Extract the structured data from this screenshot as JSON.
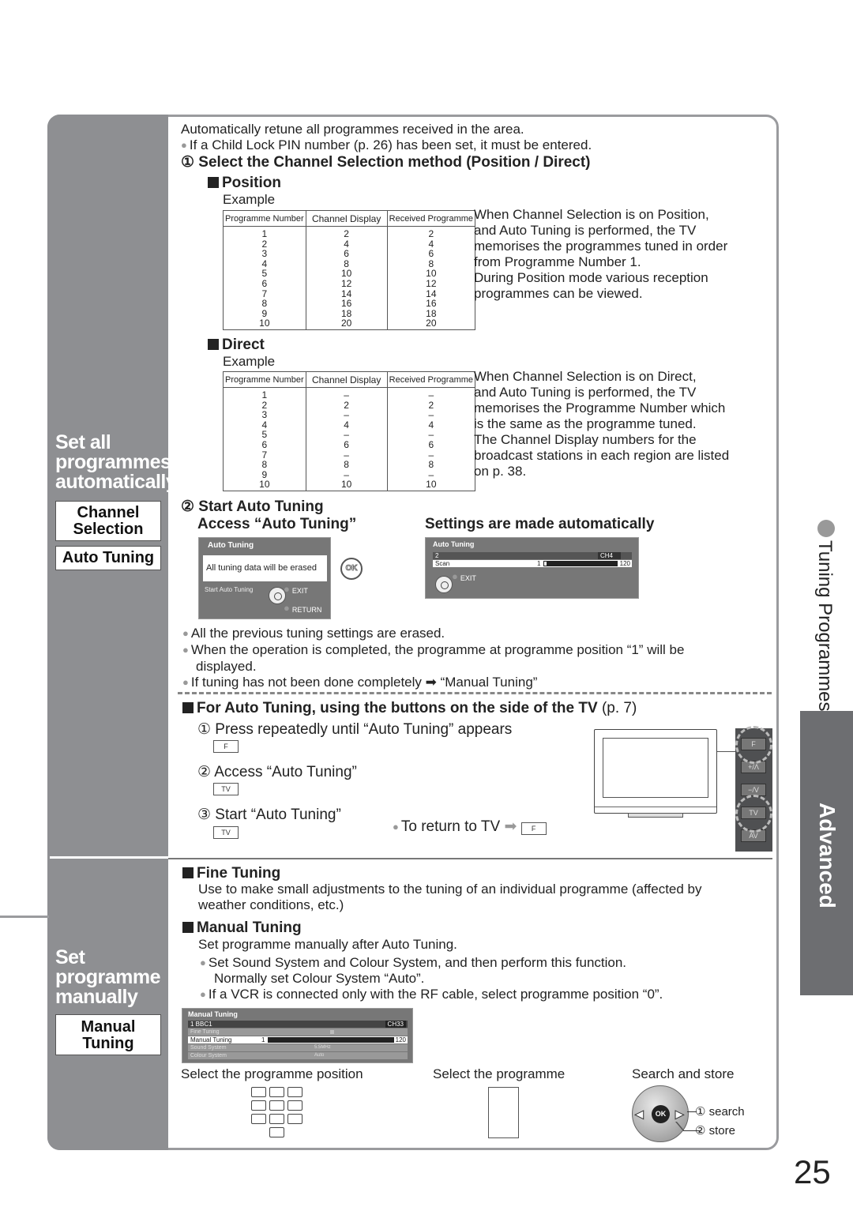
{
  "page_number": "25",
  "side_tabs": {
    "section": "Tuning Programmes",
    "chapter": "Advanced"
  },
  "sidebar": {
    "auto": {
      "title_lines": [
        "Set all",
        "programmes",
        "automatically"
      ],
      "boxes": [
        {
          "lines": [
            "Channel",
            "Selection"
          ]
        },
        {
          "lines": [
            "Auto Tuning"
          ]
        }
      ]
    },
    "manual": {
      "title_lines": [
        "Set",
        "programme",
        "manually"
      ],
      "boxes": [
        {
          "lines": [
            "Manual",
            "Tuning"
          ]
        }
      ]
    }
  },
  "auto": {
    "intro": "Automatically retune all programmes received in the area.",
    "pin_note": "If a Child Lock PIN number (p. 26) has been set, it must be entered.",
    "step1": "① Select the Channel Selection method (Position / Direct)",
    "position": {
      "heading": "Position",
      "example": "Example",
      "table": {
        "headers": [
          "Programme Number",
          "Channel Display",
          "Received Programme"
        ],
        "rows": [
          [
            "1",
            "2",
            "2"
          ],
          [
            "2",
            "4",
            "4"
          ],
          [
            "3",
            "6",
            "6"
          ],
          [
            "4",
            "8",
            "8"
          ],
          [
            "5",
            "10",
            "10"
          ],
          [
            "6",
            "12",
            "12"
          ],
          [
            "7",
            "14",
            "14"
          ],
          [
            "8",
            "16",
            "16"
          ],
          [
            "9",
            "18",
            "18"
          ],
          [
            "10",
            "20",
            "20"
          ]
        ]
      },
      "description": [
        "When Channel Selection is on Position,",
        "and Auto Tuning is performed, the TV",
        "memorises the programmes tuned in order",
        "from Programme Number 1.",
        "During Position mode various reception",
        "programmes can be viewed."
      ]
    },
    "direct": {
      "heading": "Direct",
      "example": "Example",
      "table": {
        "headers": [
          "Programme Number",
          "Channel Display",
          "Received Programme"
        ],
        "rows": [
          [
            "1",
            "–",
            "–"
          ],
          [
            "2",
            "2",
            "2"
          ],
          [
            "3",
            "–",
            "–"
          ],
          [
            "4",
            "4",
            "4"
          ],
          [
            "5",
            "–",
            "–"
          ],
          [
            "6",
            "6",
            "6"
          ],
          [
            "7",
            "–",
            "–"
          ],
          [
            "8",
            "8",
            "8"
          ],
          [
            "9",
            "–",
            "–"
          ],
          [
            "10",
            "10",
            "10"
          ]
        ]
      },
      "description": [
        "When Channel Selection is on Direct,",
        "and Auto Tuning is performed, the TV",
        "memorises the Programme Number which",
        "is the same as the programme tuned.",
        "The Channel Display numbers for the",
        "broadcast stations in each region are listed",
        "on p. 38."
      ]
    },
    "step2": {
      "title": "② Start Auto Tuning",
      "access_label": "Access “Auto Tuning”",
      "settings_label": "Settings are made automatically",
      "osd_confirm": {
        "title": "Auto Tuning",
        "message": "All tuning data will be erased",
        "start_label": "Start Auto Tuning",
        "exit": "EXIT",
        "return": "RETURN",
        "ok_button": "OK"
      },
      "osd_progress": {
        "title": "Auto Tuning",
        "programme": "2",
        "channel": "CH4",
        "scan_label": "Scan",
        "scan_min": "1",
        "scan_max": "120",
        "scan_progress_percent": 2,
        "exit": "EXIT"
      }
    },
    "notes": [
      "All the previous tuning settings are erased.",
      "When the operation is completed, the programme at programme position “1” will be displayed.",
      "If tuning has not been done completely ➡ “Manual Tuning”"
    ],
    "side_buttons": {
      "heading": "For Auto Tuning, using the buttons on the side of the TV",
      "page_ref": "(p. 7)",
      "steps": [
        {
          "text": "① Press repeatedly until “Auto Tuning” appears",
          "key": "F"
        },
        {
          "text": "② Access “Auto Tuning”",
          "key": "TV"
        },
        {
          "text": "③ Start “Auto Tuning”",
          "key": "TV"
        }
      ],
      "return_note": "To return to TV",
      "return_key": "F",
      "tv_panel_buttons": [
        "F",
        "+/Λ",
        "−/V",
        "TV",
        "AV"
      ]
    }
  },
  "manual": {
    "fine": {
      "heading": "Fine Tuning",
      "text": "Use to make small adjustments to the tuning of an individual programme (affected by weather conditions, etc.)"
    },
    "manual_tuning": {
      "heading": "Manual Tuning",
      "text": "Set programme manually after Auto Tuning.",
      "bullets": [
        "Set Sound System and Colour System, and then perform this function.",
        "Normally set Colour System “Auto”.",
        "If a VCR is connected only with the RF cable, select programme position “0”."
      ]
    },
    "osd": {
      "title": "Manual Tuning",
      "programme": "1 BBC1",
      "channel": "CH33",
      "rows": [
        {
          "label": "Fine Tuning",
          "value": ""
        },
        {
          "label": "Manual Tuning",
          "min": "1",
          "max": "120"
        },
        {
          "label": "Sound System",
          "value": "5.5MHz"
        },
        {
          "label": "Colour System",
          "value": "Auto"
        }
      ]
    },
    "captions": {
      "select_position": "Select the programme position",
      "select_programme": "Select the programme",
      "search_store": "Search and store",
      "search": "① search",
      "store": "② store",
      "ok": "OK"
    }
  }
}
